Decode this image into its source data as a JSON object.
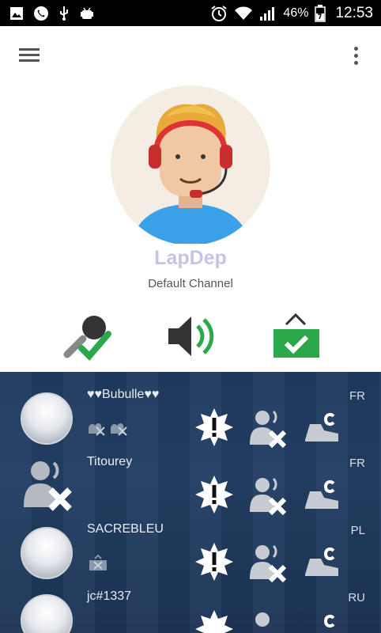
{
  "status_bar": {
    "battery": "46%",
    "time": "12:53",
    "icons_left": [
      "image-icon",
      "phone-icon",
      "usb-icon",
      "android-debug-icon"
    ],
    "icons_right": [
      "alarm-icon",
      "wifi-icon",
      "signal-icon",
      "battery-icon"
    ]
  },
  "profile": {
    "nickname": "LapDep",
    "channel": "Default Channel"
  },
  "controls": {
    "mic": "microphone-enabled",
    "speaker": "speaker-enabled",
    "status": "away-ok"
  },
  "users": [
    {
      "name": "♥♥Bubulle♥♥",
      "country": "FR"
    },
    {
      "name": "Titourey",
      "country": "FR"
    },
    {
      "name": "SACREBLEU",
      "country": "PL"
    },
    {
      "name": "jc#1337",
      "country": "RU"
    }
  ],
  "colors": {
    "accent_green": "#22aa3a",
    "list_bg": "#1f3a5f",
    "nickname": "#c4c4e8"
  }
}
